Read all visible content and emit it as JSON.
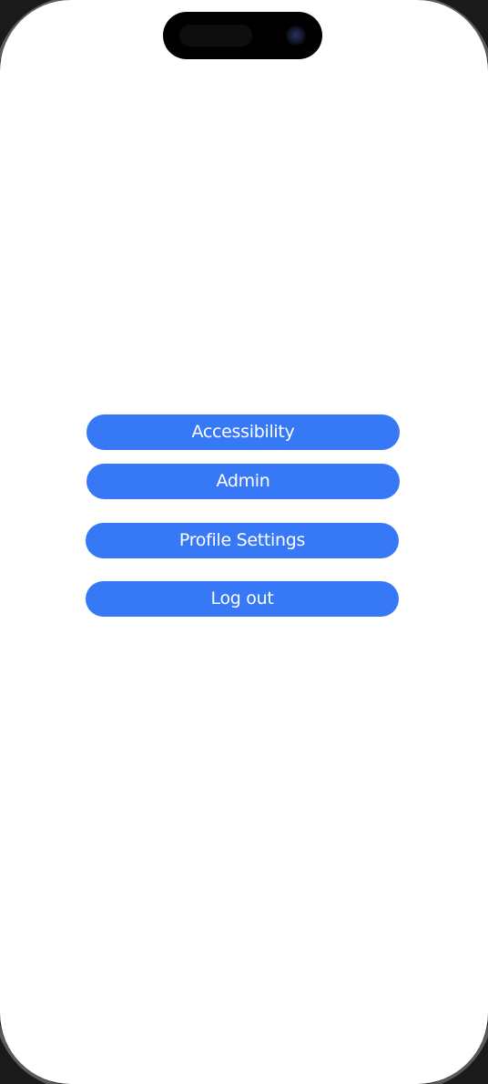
{
  "menu": {
    "accessibility_label": "Accessibility",
    "admin_label": "Admin",
    "profile_settings_label": "Profile Settings",
    "logout_label": "Log out"
  },
  "colors": {
    "button_background": "#3678f6",
    "button_text": "#ffffff",
    "screen_background": "#ffffff"
  }
}
